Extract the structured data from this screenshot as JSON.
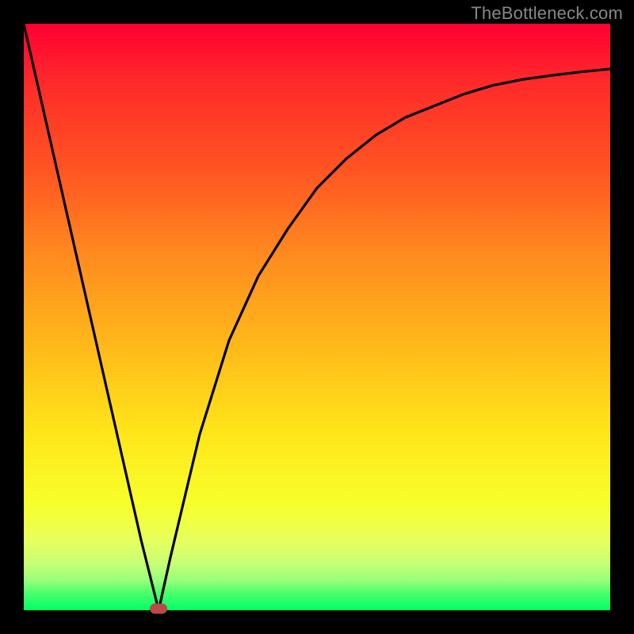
{
  "watermark": "TheBottleneck.com",
  "chart_data": {
    "type": "line",
    "title": "",
    "xlabel": "",
    "ylabel": "",
    "xlim": [
      0,
      100
    ],
    "ylim": [
      0,
      100
    ],
    "grid": false,
    "legend": false,
    "series": [
      {
        "name": "bottleneck-curve",
        "x": [
          0,
          5,
          10,
          15,
          20,
          23,
          25,
          30,
          35,
          40,
          45,
          50,
          55,
          60,
          65,
          70,
          75,
          80,
          85,
          90,
          95,
          100
        ],
        "y": [
          100,
          78,
          56,
          34,
          12,
          0,
          9,
          30,
          46,
          57,
          65,
          72,
          77,
          81,
          84,
          86,
          88,
          89.5,
          90.5,
          91.2,
          91.8,
          92.3
        ]
      }
    ],
    "marker": {
      "x": 23,
      "y": 0
    },
    "gradient_stops": [
      {
        "pct": 0,
        "color": "#ff0033"
      },
      {
        "pct": 25,
        "color": "#ff5522"
      },
      {
        "pct": 55,
        "color": "#ffb91a"
      },
      {
        "pct": 82,
        "color": "#f7ff2b"
      },
      {
        "pct": 100,
        "color": "#00ff66"
      }
    ]
  }
}
